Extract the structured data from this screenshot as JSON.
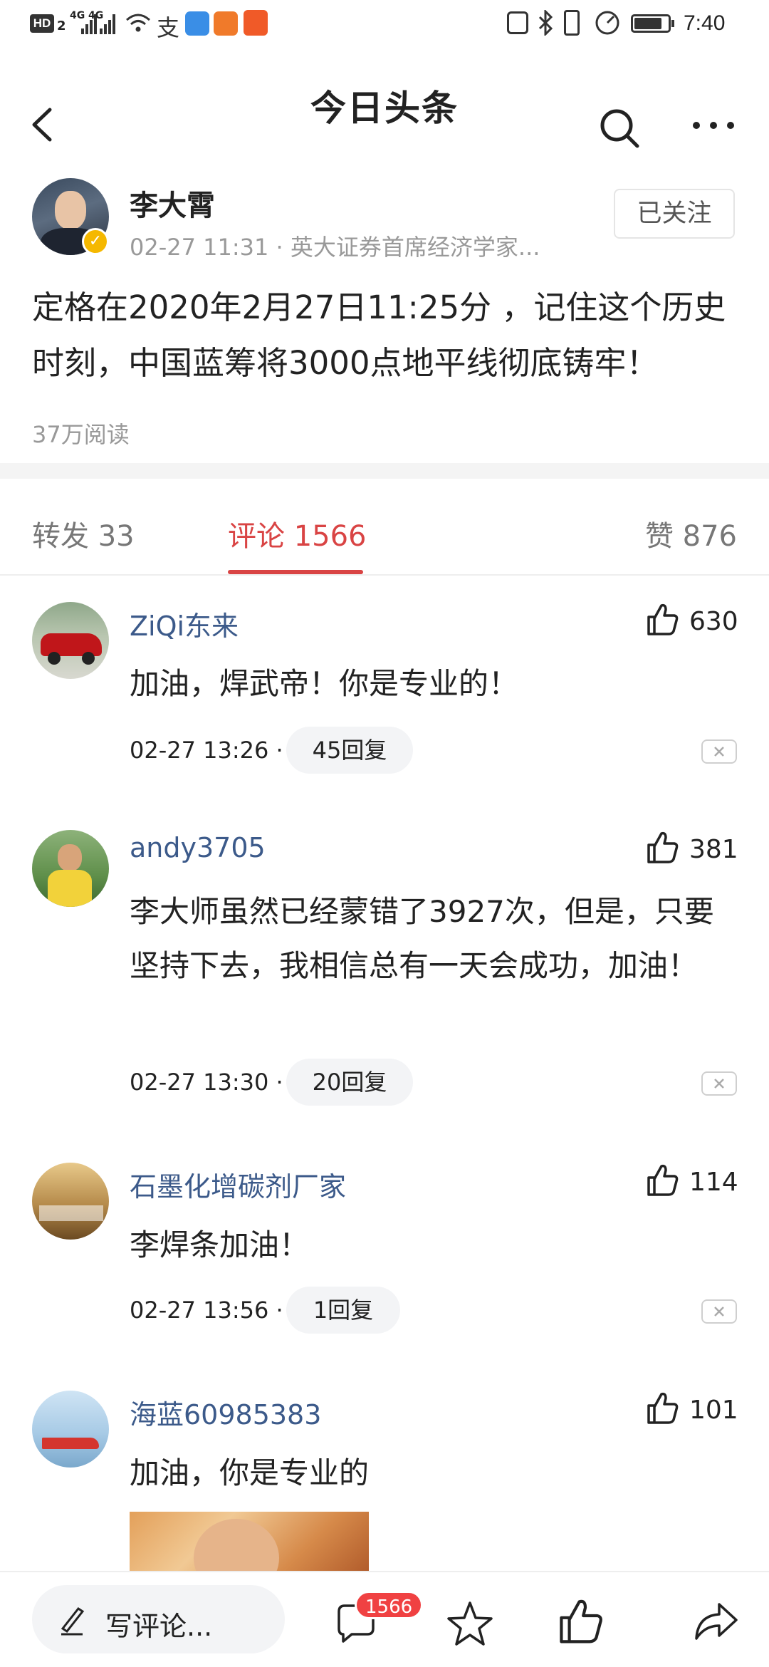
{
  "status": {
    "time": "7:40",
    "hd": "HD",
    "sim": "2",
    "net1": "4G",
    "net2": "4G",
    "battery_level": 0.8
  },
  "nav": {
    "title": "今日头条"
  },
  "author": {
    "name": "李大霄",
    "meta": "02-27 11:31 · 英大证券首席经济学家...",
    "follow_label": "已关注"
  },
  "post": {
    "text": "定格在2020年2月27日11:25分 ，记住这个历史时刻，中国蓝筹将3000点地平线彻底铸牢！",
    "read_count": "37万阅读"
  },
  "tabs": {
    "repost": "转发 33",
    "comments": "评论 1566",
    "likes": "赞 876"
  },
  "comments": [
    {
      "name": "ZiQi东来",
      "likes": "630",
      "text": "加油，焊武帝！你是专业的！",
      "time": "02-27 13:26 ·",
      "replies": "45回复"
    },
    {
      "name": "andy3705",
      "likes": "381",
      "text": "李大师虽然已经蒙错了3927次，但是，只要坚持下去，我相信总有一天会成功，加油！",
      "time": "02-27 13:30 ·",
      "replies": "20回复"
    },
    {
      "name": "石墨化增碳剂厂家",
      "likes": "114",
      "text": "李焊条加油！",
      "time": "02-27 13:56 ·",
      "replies": "1回复"
    },
    {
      "name": "海蓝60985383",
      "likes": "101",
      "text": "加油，你是专业的"
    }
  ],
  "bottom": {
    "write_label": "写评论...",
    "comment_badge": "1566"
  },
  "colors": {
    "accent": "#d94444",
    "name_blue": "#3c5a8a",
    "badge_red": "#f04142"
  }
}
